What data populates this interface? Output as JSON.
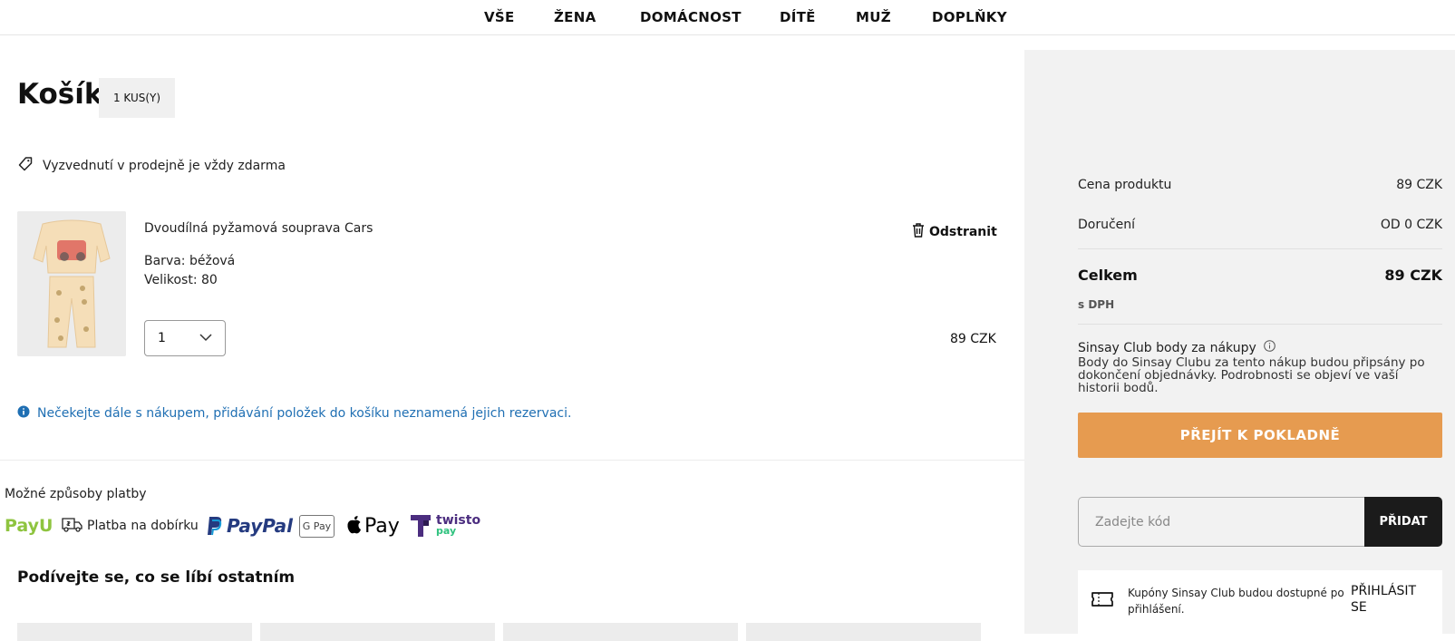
{
  "nav": {
    "items": [
      {
        "label": "VŠE"
      },
      {
        "label": "ŽENA"
      },
      {
        "label": "DOMÁCNOST"
      },
      {
        "label": "DÍTĚ"
      },
      {
        "label": "MUŽ"
      },
      {
        "label": "DOPLŇKY"
      }
    ]
  },
  "cart": {
    "title": "Košík",
    "count_badge": "1 KUS(Y)",
    "free_pickup": "Vyzvednutí v prodejně je vždy zdarma",
    "item": {
      "name": "Dvoudílná pyžamová souprava Cars",
      "color": "Barva: béžová",
      "size": "Velikost: 80",
      "remove_label": "Odstranit",
      "quantity": "1",
      "price": "89 CZK"
    },
    "notice": "Nečekejte dále s nákupem, přidávání položek do košíku neznamená jejich rezervaci."
  },
  "payment": {
    "title": "Možné způsoby platby",
    "cod_label": "Platba na dobírku",
    "logos": {
      "payu": "PayU",
      "paypal": "PayPal",
      "gpay": "G Pay",
      "applepay": "Pay",
      "twisto_top": "twisto",
      "twisto_bottom": "pay"
    }
  },
  "recommendations": {
    "title": "Podívejte se, co se líbí ostatním"
  },
  "summary": {
    "product_price_label": "Cena produktu",
    "product_price_value": "89 CZK",
    "delivery_label": "Doručení",
    "delivery_value": "OD 0 CZK",
    "total_label": "Celkem",
    "total_value": "89 CZK",
    "vat_note": "s DPH",
    "club_title": "Sinsay Club body za nákupy",
    "club_desc": "Body do Sinsay Clubu za tento nákup budou připsány po dokončení objednávky. Podrobnosti se objeví ve vaší historii bodů.",
    "checkout_label": "PŘEJÍT K POKLADNĚ",
    "code_placeholder": "Zadejte kód",
    "add_label": "PŘIDAT",
    "coupon_text": "Kupóny Sinsay Club budou dostupné po přihlášení.",
    "login_label": "PŘIHLÁSIT SE"
  },
  "colors": {
    "checkout_button": "#e69b50",
    "notice_text": "#1f6fb3",
    "summary_background": "#f2f2f2",
    "add_button": "#1b1b1b"
  }
}
